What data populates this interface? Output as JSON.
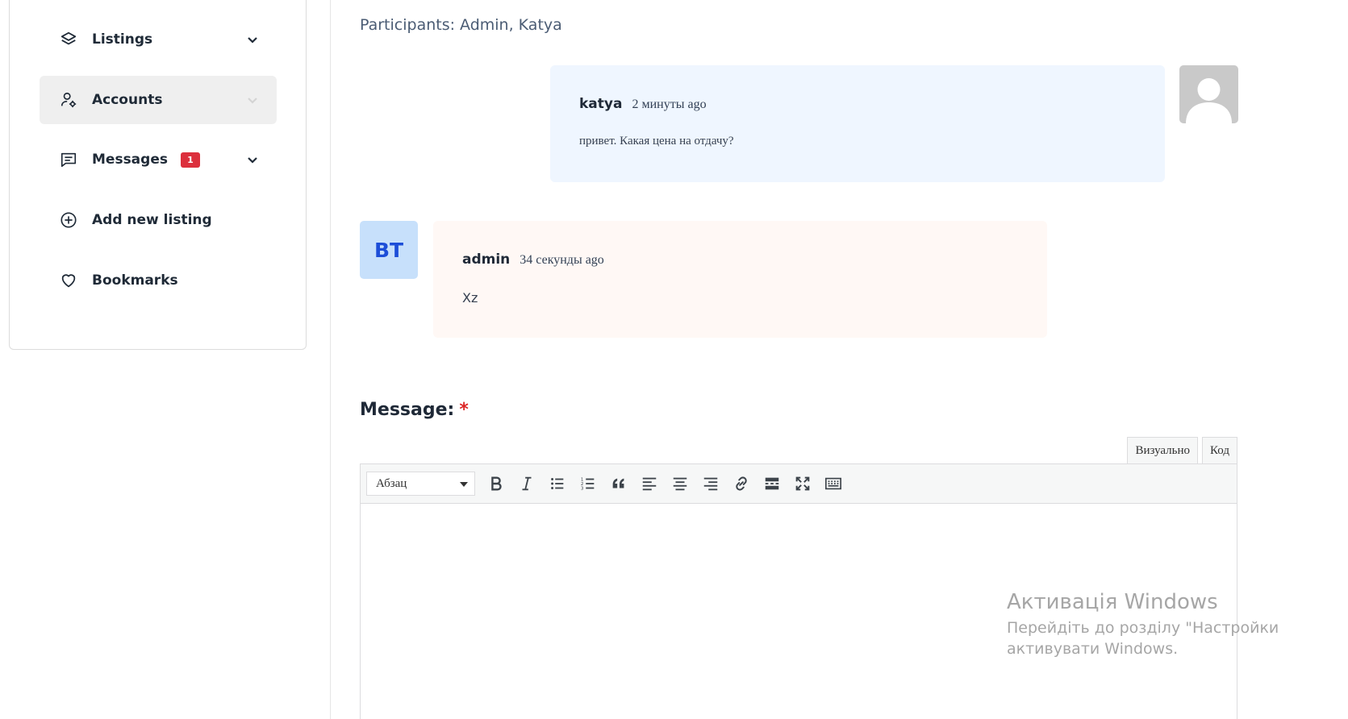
{
  "sidebar": {
    "items": [
      {
        "label": "Listings",
        "icon": "layers-icon",
        "has_chevron": true
      },
      {
        "label": "Accounts",
        "icon": "user-gear-icon",
        "has_chevron": true,
        "active": true
      },
      {
        "label": "Messages",
        "icon": "message-icon",
        "has_chevron": true,
        "badge": "1"
      },
      {
        "label": "Add new listing",
        "icon": "plus-circle-icon",
        "has_chevron": false
      },
      {
        "label": "Bookmarks",
        "icon": "heart-icon",
        "has_chevron": false
      }
    ]
  },
  "conversation": {
    "participants": "Participants: Admin, Katya",
    "messages": [
      {
        "author": "katya",
        "time": "2 минуты ago",
        "body": "привет. Какая цена на отдачу?",
        "avatar": "default-user-avatar"
      },
      {
        "author": "admin",
        "time": "34 секунды ago",
        "body": "Xz",
        "avatar_initials": "BT"
      }
    ]
  },
  "composer": {
    "label": "Message:",
    "required_mark": "*",
    "tabs": {
      "visual": "Визуально",
      "code": "Код"
    },
    "format_select": "Абзац",
    "toolbar_icons": [
      "bold-icon",
      "italic-icon",
      "bullet-list-icon",
      "numbered-list-icon",
      "blockquote-icon",
      "align-left-icon",
      "align-center-icon",
      "align-right-icon",
      "link-icon",
      "read-more-icon",
      "fullscreen-icon",
      "toolbar-toggle-icon"
    ]
  },
  "watermark": {
    "title": "Активація Windows",
    "line1": "Перейдіть до розділу \"Настройки",
    "line2": "активувати Windows."
  },
  "colors": {
    "accent_badge": "#dc2f3c",
    "bubble_right": "#eff6ff",
    "bubble_left": "#fff8f5",
    "initials_avatar_bg": "#c7e0fb"
  }
}
